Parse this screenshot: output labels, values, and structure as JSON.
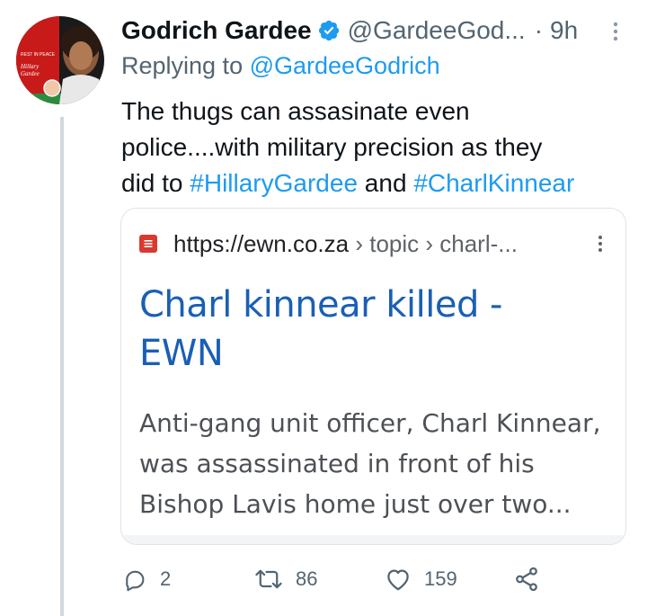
{
  "tweet": {
    "author_name": "Godrich Gardee",
    "handle": "@GardeeGod...",
    "separator": "·",
    "time": "9h",
    "replying_prefix": "Replying to ",
    "replying_to": "@GardeeGodrich",
    "text_line1": "The thugs can assasinate even",
    "text_line2": "police....with military precision as they",
    "text_line3_prefix": "did to ",
    "hashtag1": "#HillaryGardee",
    "text_line3_mid": " and ",
    "hashtag2": "#CharlKinnear"
  },
  "avatar": {
    "text_top": "REST IN PEACE",
    "text_name1": "Hillary",
    "text_name2": "Gardee"
  },
  "card": {
    "url_domain": "https://ewn.co.za",
    "url_crumbs": " › topic › charl-...",
    "title_line1": "Charl kinnear killed -",
    "title_line2": "EWN",
    "desc_line1": "Anti-gang unit officer, Charl Kinnear,",
    "desc_line2": "was assassinated in front of his",
    "desc_line3": "Bishop Lavis home just over two..."
  },
  "actions": {
    "reply_count": "2",
    "retweet_count": "86",
    "like_count": "159"
  },
  "colors": {
    "accent": "#1d9bf0",
    "card_title": "#1a5fb4",
    "favicon": "#d9392f",
    "muted": "#536471"
  },
  "icons": {
    "verified": "verified-badge-icon",
    "more": "more-vertical-icon",
    "reply": "reply-icon",
    "retweet": "retweet-icon",
    "like": "heart-icon",
    "share": "share-icon"
  }
}
